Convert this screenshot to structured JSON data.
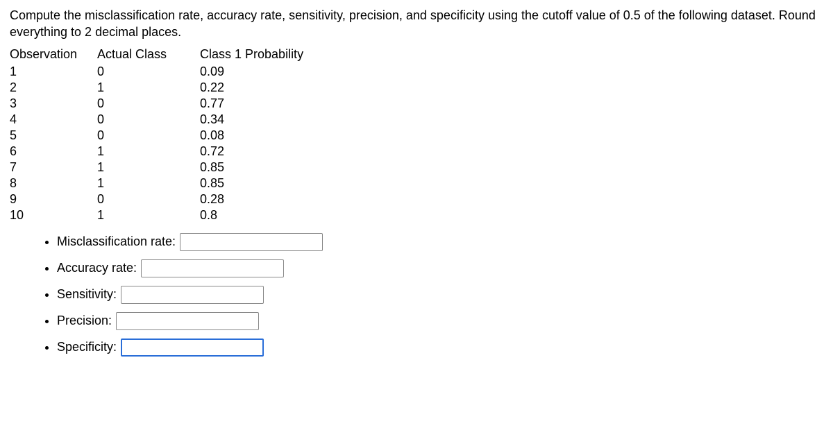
{
  "intro": "Compute the misclassification rate, accuracy rate, sensitivity, precision, and specificity using the cutoff value of 0.5 of the following dataset. Round everything to 2 decimal places.",
  "table": {
    "headers": {
      "obs": "Observation",
      "actual": "Actual Class",
      "prob": "Class 1 Probability"
    },
    "rows": [
      {
        "obs": "1",
        "actual": "0",
        "prob": "0.09"
      },
      {
        "obs": "2",
        "actual": "1",
        "prob": "0.22"
      },
      {
        "obs": "3",
        "actual": "0",
        "prob": "0.77"
      },
      {
        "obs": "4",
        "actual": "0",
        "prob": "0.34"
      },
      {
        "obs": "5",
        "actual": "0",
        "prob": "0.08"
      },
      {
        "obs": "6",
        "actual": "1",
        "prob": "0.72"
      },
      {
        "obs": "7",
        "actual": "1",
        "prob": "0.85"
      },
      {
        "obs": "8",
        "actual": "1",
        "prob": "0.85"
      },
      {
        "obs": "9",
        "actual": "0",
        "prob": "0.28"
      },
      {
        "obs": "10",
        "actual": "1",
        "prob": "0.8"
      }
    ]
  },
  "fields": {
    "misclassification": {
      "label": "Misclassification rate:",
      "value": ""
    },
    "accuracy": {
      "label": "Accuracy rate:",
      "value": ""
    },
    "sensitivity": {
      "label": "Sensitivity:",
      "value": ""
    },
    "precision": {
      "label": "Precision:",
      "value": ""
    },
    "specificity": {
      "label": "Specificity:",
      "value": ""
    }
  }
}
